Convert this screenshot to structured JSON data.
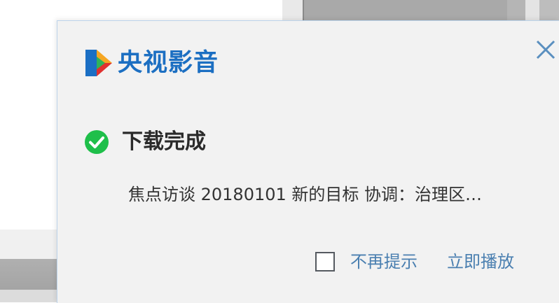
{
  "app": {
    "brand_name": "央视影音",
    "logo_icon": "cctv-play-logo-icon",
    "accent_color": "#1c6fc2"
  },
  "notification": {
    "status_icon": "check-circle-icon",
    "status_color": "#1fbf4a",
    "title": "下载完成",
    "file_name": "焦点访谈  20180101 新的目标 协调：治理区…",
    "close_icon": "close-icon"
  },
  "footer": {
    "dont_remind_label": "不再提示",
    "dont_remind_checked": false,
    "play_now_label": "立即播放",
    "link_color": "#4a7fb0"
  }
}
